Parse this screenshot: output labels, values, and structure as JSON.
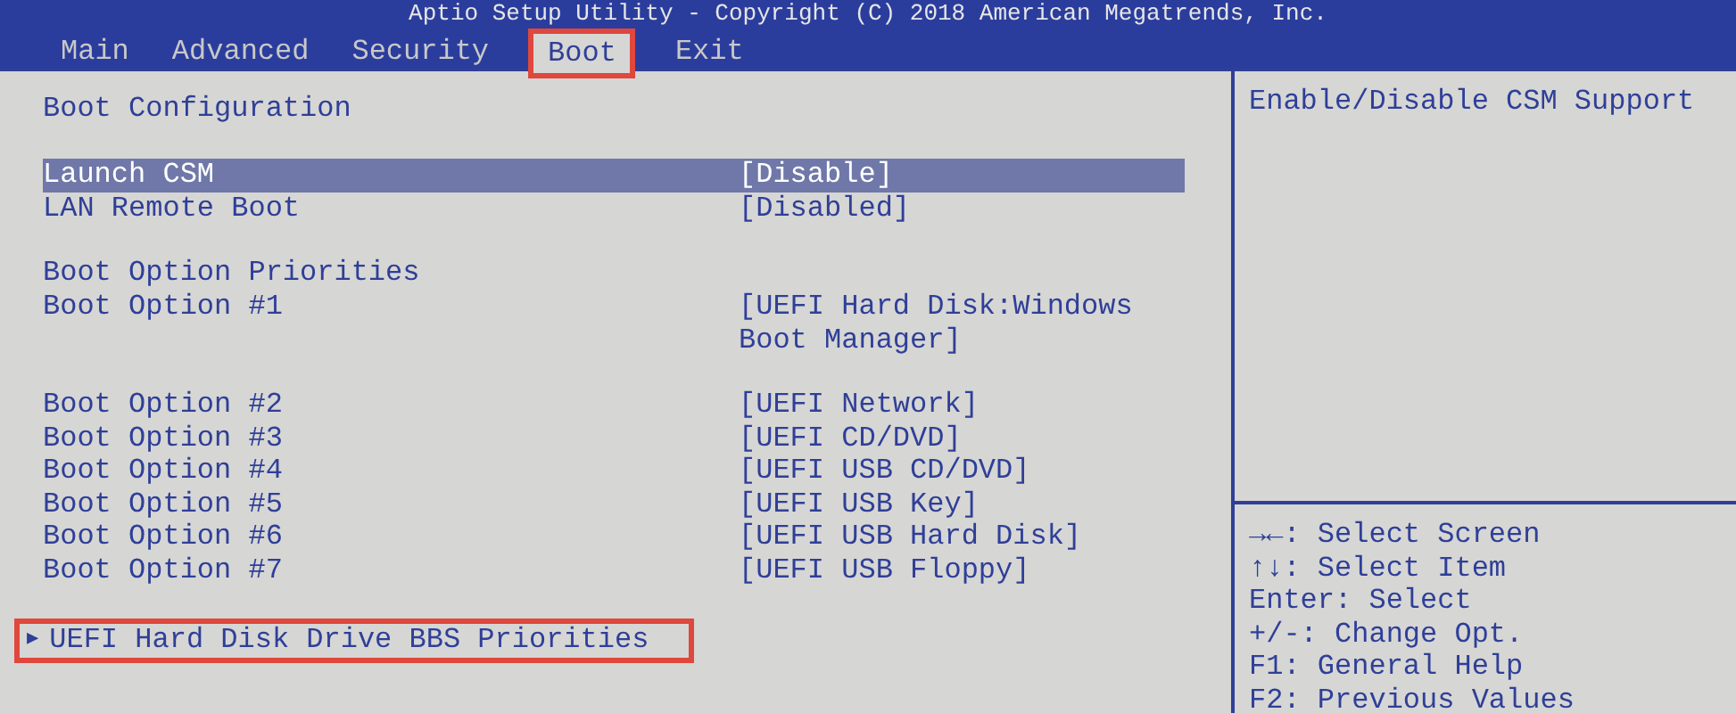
{
  "header": {
    "title": "Aptio Setup Utility - Copyright (C) 2018 American Megatrends, Inc."
  },
  "tabs": [
    {
      "label": "Main",
      "selected": false,
      "annotated": false
    },
    {
      "label": "Advanced",
      "selected": false,
      "annotated": false
    },
    {
      "label": "Security",
      "selected": false,
      "annotated": false
    },
    {
      "label": "Boot",
      "selected": true,
      "annotated": true
    },
    {
      "label": "Exit",
      "selected": false,
      "annotated": false
    }
  ],
  "groups": [
    {
      "items": [
        {
          "kind": "header",
          "label": "Boot Configuration"
        }
      ]
    },
    {
      "items": [
        {
          "kind": "setting",
          "label": "Launch CSM",
          "value": "[Disable]",
          "selected": true
        },
        {
          "kind": "setting",
          "label": "LAN Remote Boot",
          "value": "[Disabled]",
          "selected": false
        }
      ]
    },
    {
      "items": [
        {
          "kind": "header",
          "label": "Boot Option Priorities"
        },
        {
          "kind": "setting",
          "label": "Boot Option #1",
          "value": "[UEFI Hard Disk:Windows Boot Manager]",
          "selected": false
        }
      ]
    },
    {
      "items": [
        {
          "kind": "setting",
          "label": "Boot Option #2",
          "value": "[UEFI Network]",
          "selected": false
        },
        {
          "kind": "setting",
          "label": "Boot Option #3",
          "value": "[UEFI CD/DVD]",
          "selected": false
        },
        {
          "kind": "setting",
          "label": "Boot Option #4",
          "value": "[UEFI USB CD/DVD]",
          "selected": false
        },
        {
          "kind": "setting",
          "label": "Boot Option #5",
          "value": "[UEFI USB Key]",
          "selected": false
        },
        {
          "kind": "setting",
          "label": "Boot Option #6",
          "value": "[UEFI USB Hard Disk]",
          "selected": false
        },
        {
          "kind": "setting",
          "label": "Boot Option #7",
          "value": "[UEFI USB Floppy]",
          "selected": false
        }
      ]
    },
    {
      "items": [
        {
          "kind": "submenu",
          "marker": "▶",
          "label": "UEFI Hard Disk Drive BBS Priorities",
          "selected": false,
          "annotated": true
        }
      ]
    }
  ],
  "help": {
    "text": "Enable/Disable CSM Support"
  },
  "keys": [
    {
      "key": "→←:",
      "action": "Select Screen"
    },
    {
      "key": "↑↓:",
      "action": "Select Item"
    },
    {
      "key": "Enter:",
      "action": "Select"
    },
    {
      "key": "+/-:",
      "action": "Change Opt."
    },
    {
      "key": "F1:",
      "action": "General Help"
    },
    {
      "key": "F2:",
      "action": "Previous Values"
    }
  ]
}
